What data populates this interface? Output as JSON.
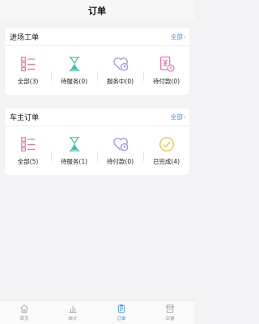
{
  "header": {
    "title": "订单"
  },
  "section_entry": {
    "title": "进场工单",
    "all_label": "全部",
    "items": [
      {
        "label": "全部(3)",
        "icon": "list-icon"
      },
      {
        "label": "待服务(0)",
        "icon": "hourglass-icon"
      },
      {
        "label": "服务中(0)",
        "icon": "heart-clock-icon"
      },
      {
        "label": "待付款(0)",
        "icon": "payment-icon"
      }
    ]
  },
  "section_owner": {
    "title": "车主订单",
    "all_label": "全部",
    "items": [
      {
        "label": "全部(5)",
        "icon": "list-icon"
      },
      {
        "label": "待服务(1)",
        "icon": "hourglass-icon"
      },
      {
        "label": "待付款(0)",
        "icon": "heart-clock-icon"
      },
      {
        "label": "已完成(4)",
        "icon": "check-circle-icon"
      }
    ]
  },
  "tabbar": {
    "items": [
      {
        "label": "首页",
        "icon": "home-icon"
      },
      {
        "label": "统计",
        "icon": "bar-chart-icon"
      },
      {
        "label": "订单",
        "icon": "order-icon",
        "active": true
      },
      {
        "label": "店铺",
        "icon": "store-icon"
      }
    ]
  },
  "colors": {
    "accent": "#3a8ef6",
    "pink": "#f070a8",
    "teal": "#3cc4ab",
    "purple": "#9a86e6",
    "yellow": "#e9c62a"
  }
}
